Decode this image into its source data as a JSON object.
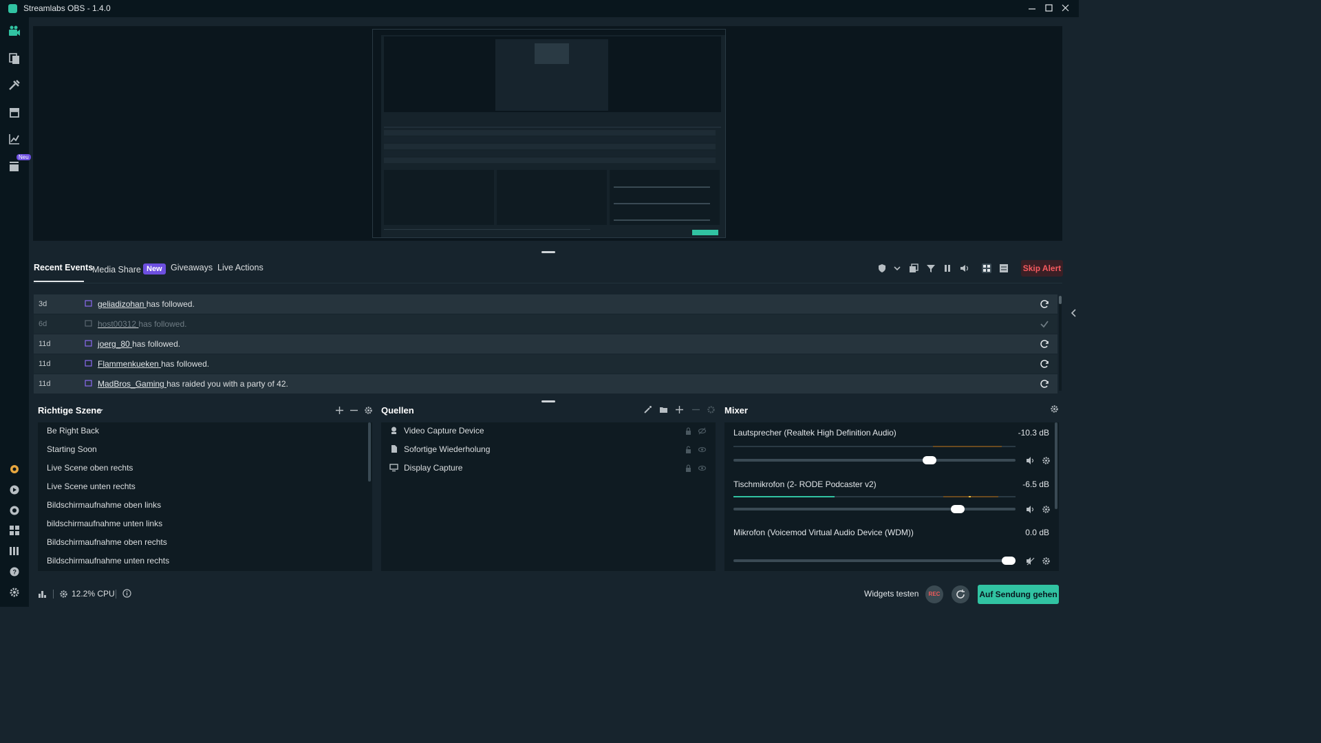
{
  "window": {
    "title": "Streamlabs OBS - 1.4.0"
  },
  "nav": {
    "badge": "Neu",
    "icons": [
      "editor-icon",
      "themes-icon",
      "tools-icon",
      "store-icon",
      "stats-icon",
      "highlighter-icon"
    ],
    "bottom_icons": [
      "patreon-icon",
      "play-icon",
      "chat-icon",
      "grid-icon",
      "library-icon",
      "help-icon",
      "settings-icon"
    ]
  },
  "events": {
    "tabs": {
      "recent": "Recent Events",
      "media_share": "Media Share",
      "new_badge": "New",
      "giveaways": "Giveaways",
      "live_actions": "Live Actions"
    },
    "skip_alert": "Skip Alert",
    "rows": [
      {
        "time": "3d",
        "user": "geliadizohan",
        "action": "has followed.",
        "dimmed": false
      },
      {
        "time": "6d",
        "user": "host00312",
        "action": "has followed.",
        "dimmed": true
      },
      {
        "time": "11d",
        "user": "joerg_80",
        "action": "has followed.",
        "dimmed": false
      },
      {
        "time": "11d",
        "user": "Flammenkueken",
        "action": "has followed.",
        "dimmed": false
      },
      {
        "time": "11d",
        "user": "MadBros_Gaming",
        "action": "has raided you with a party of 42.",
        "dimmed": false
      }
    ]
  },
  "scenes": {
    "title": "Richtige Szene",
    "items": [
      "Be Right Back",
      "Starting Soon",
      "Live Scene oben rechts",
      "Live Scene unten rechts",
      "Bildschirmaufnahme oben links",
      "bildschirmaufnahme unten links",
      "Bildschirmaufnahme oben rechts",
      "Bildschirmaufnahme unten rechts"
    ]
  },
  "sources": {
    "title": "Quellen",
    "items": [
      "Video Capture Device",
      "Sofortige Wiederholung",
      "Display Capture"
    ]
  },
  "mixer": {
    "title": "Mixer",
    "channels": [
      {
        "name": "Lautsprecher (Realtek High Definition Audio)",
        "db": "-10.3 dB",
        "level": 0.72
      },
      {
        "name": "Tischmikrofon (2- RODE Podcaster v2)",
        "db": "-6.5 dB",
        "level": 0.82
      },
      {
        "name": "Mikrofon (Voicemod Virtual Audio Device (WDM))",
        "db": "0.0 dB",
        "level": 1.0
      }
    ]
  },
  "footer": {
    "cpu": "12.2% CPU",
    "widgets_test": "Widgets testen",
    "rec": "REC",
    "go_live": "Auf Sendung gehen"
  },
  "colors": {
    "accent": "#31c3a2",
    "danger": "#f65a5f",
    "badge": "#6d4fe0"
  }
}
